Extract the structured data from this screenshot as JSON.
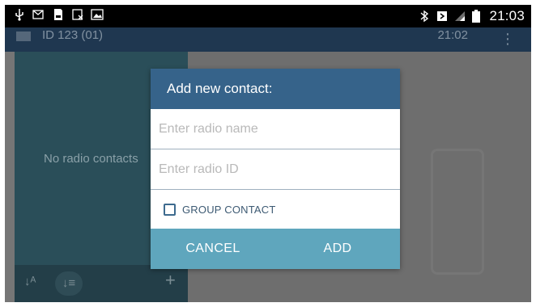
{
  "status_bar": {
    "left_icons": [
      "usb-icon",
      "mail-icon",
      "sd-card-icon",
      "no-sim-icon",
      "image-icon"
    ],
    "right_icons": [
      "bluetooth-icon",
      "nfc-icon",
      "signal-icon",
      "battery-icon"
    ],
    "time": "21:03"
  },
  "app_bar": {
    "title": "ID 123 (01)",
    "time": "21:02",
    "menu_icon": "overflow-menu-icon"
  },
  "contacts_panel": {
    "empty_text": "No radio contacts",
    "bottom_icons": [
      "sort-alpha-icon",
      "sort-numeric-icon",
      "add-icon"
    ],
    "add_glyph": "+"
  },
  "dialog": {
    "title": "Add new contact:",
    "name_placeholder": "Enter radio name",
    "id_placeholder": "Enter radio ID",
    "group_label": "GROUP CONTACT",
    "group_checked": false,
    "cancel_label": "CANCEL",
    "add_label": "ADD"
  },
  "colors": {
    "dialog_header": "#36638a",
    "dialog_buttons": "#5fa6bd",
    "left_panel": "#2a4e59"
  }
}
